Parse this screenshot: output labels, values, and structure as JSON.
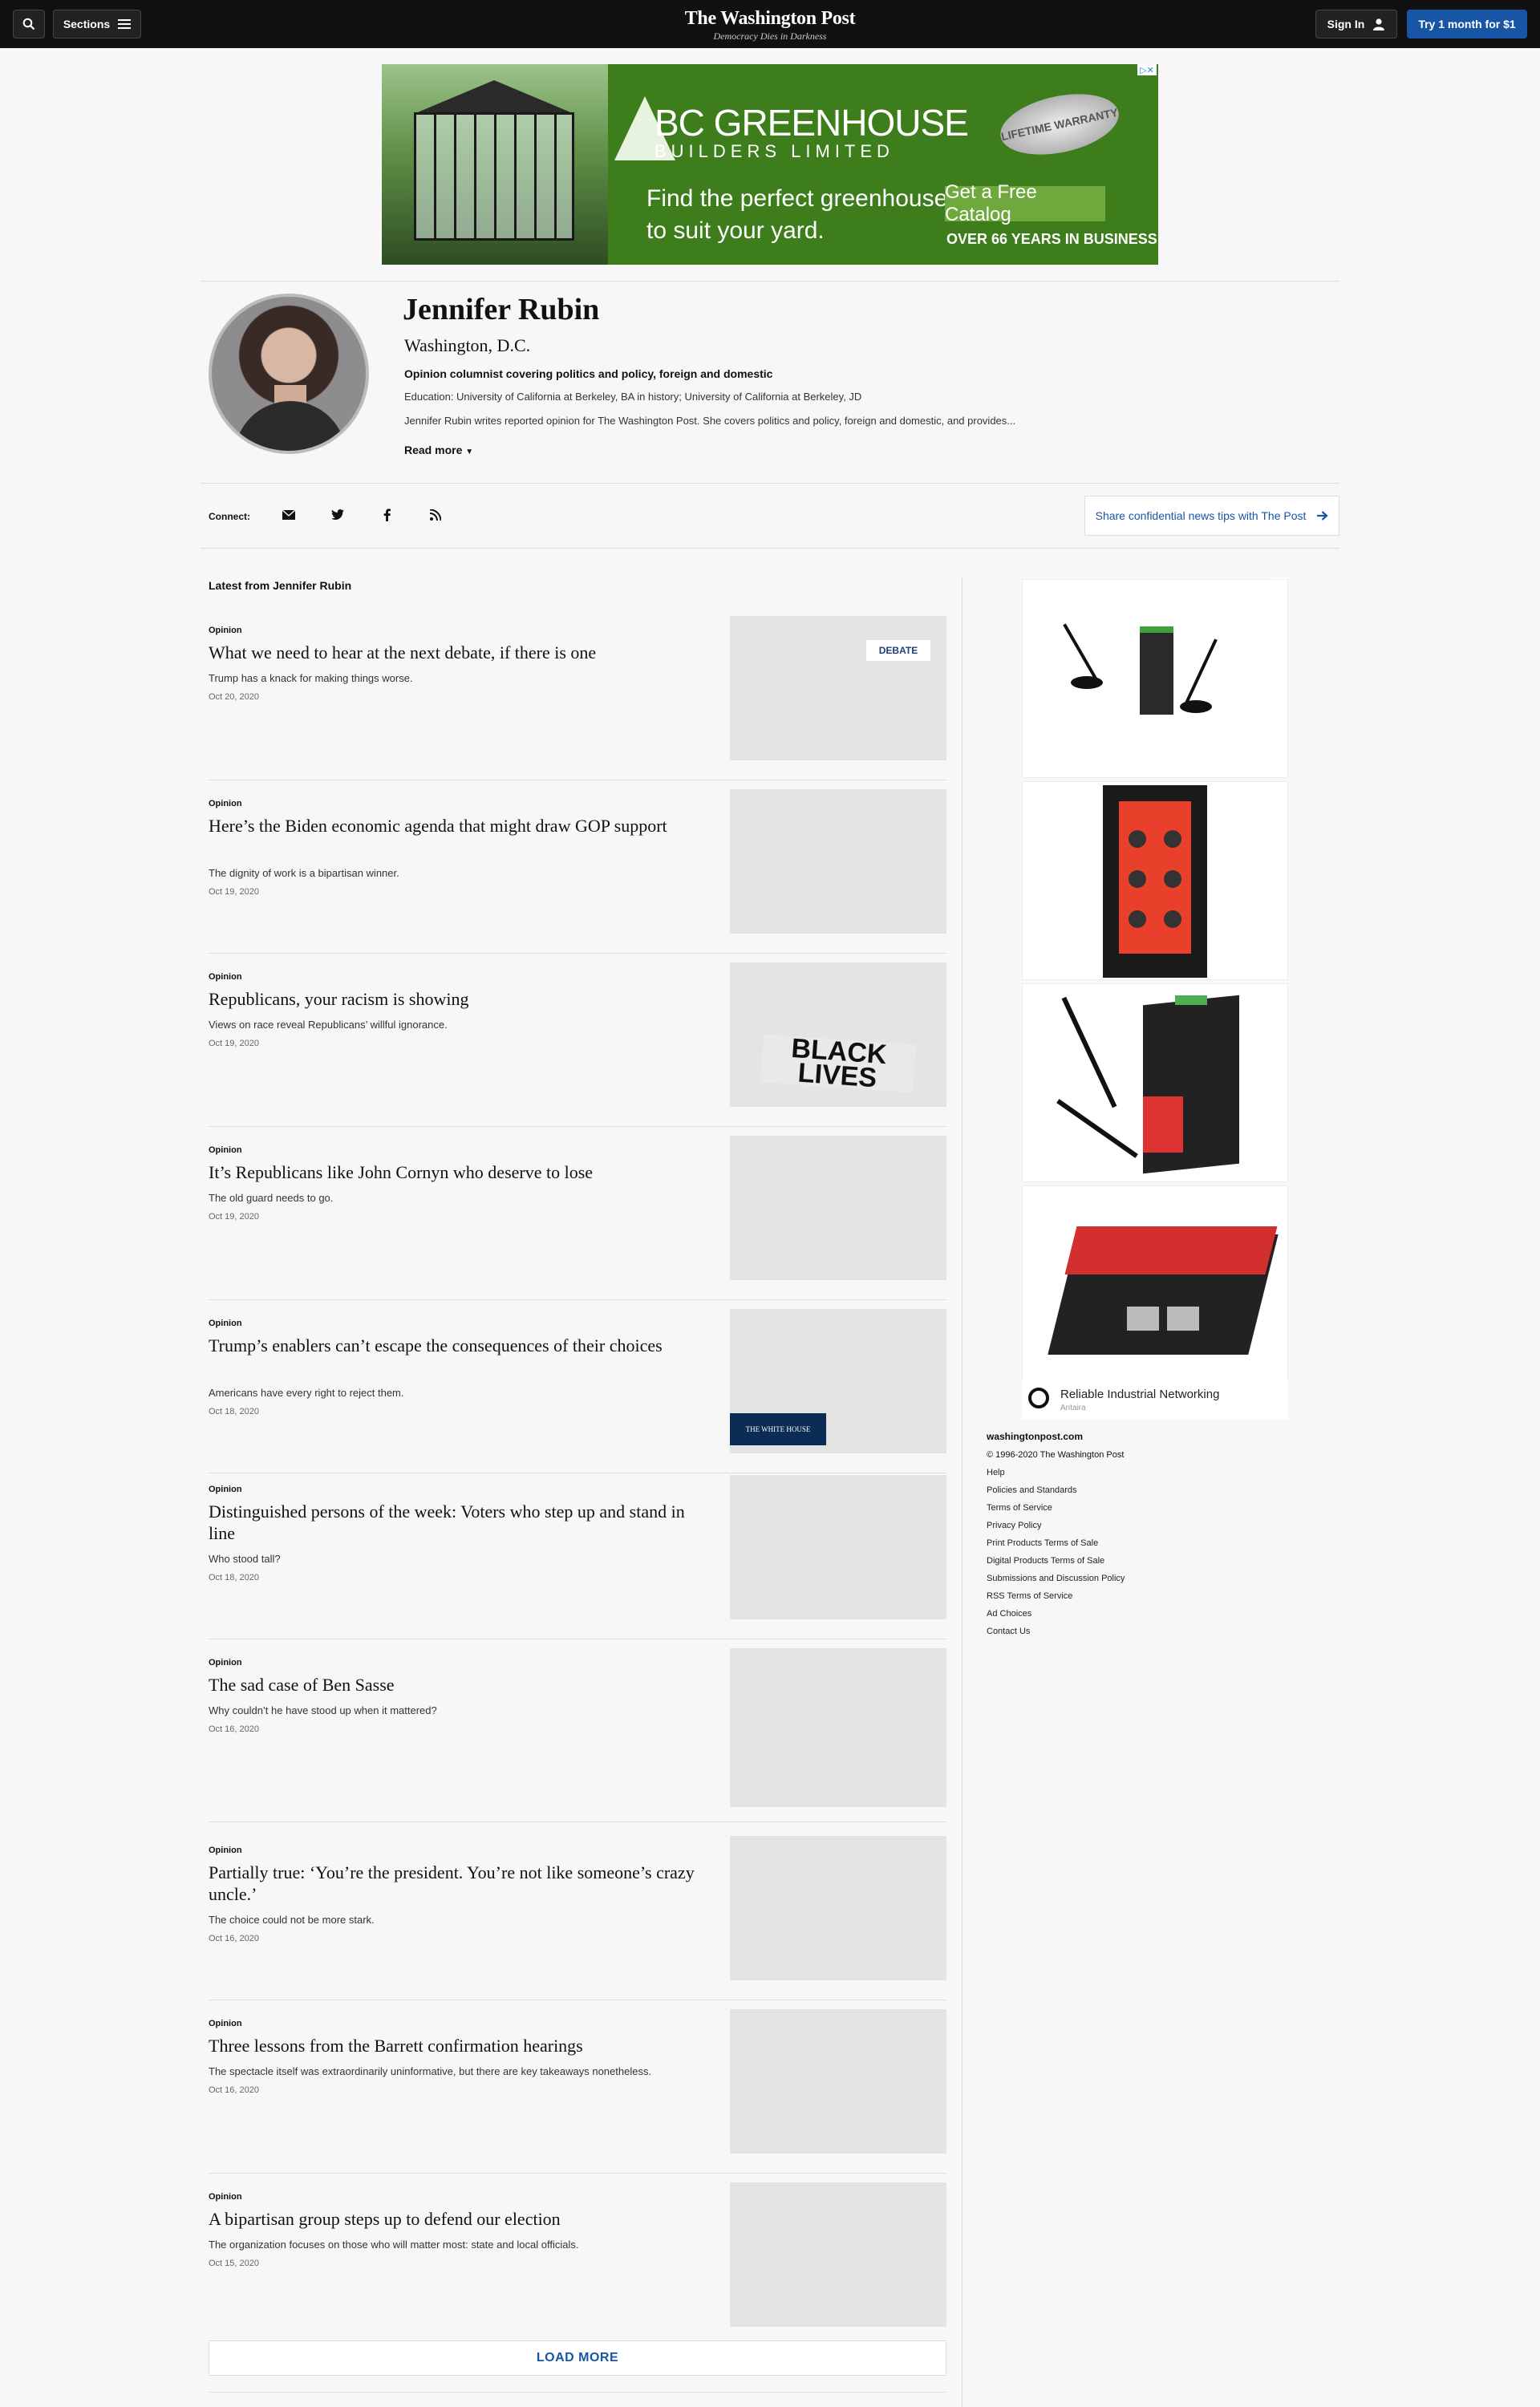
{
  "header": {
    "sections_label": "Sections",
    "logo": "The Washington Post",
    "tagline": "Democracy Dies in Darkness",
    "signin_label": "Sign In",
    "subscribe_label": "Try 1 month for $1"
  },
  "top_ad": {
    "brand_line1": "BC GREENHOUSE",
    "brand_line2": "BUILDERS LIMITED",
    "seal": "LIFETIME WARRANTY",
    "headline_line1": "Find the perfect greenhouse",
    "headline_line2": "to suit your yard.",
    "cta": "Get a Free Catalog",
    "years": "OVER 66 YEARS IN BUSINESS"
  },
  "author": {
    "name": "Jennifer Rubin",
    "location": "Washington, D.C.",
    "role": "Opinion columnist covering politics and policy, foreign and domestic",
    "education": "Education: University of California at Berkeley, BA in history; University of California at Berkeley, JD",
    "bio": "Jennifer Rubin writes reported opinion for The Washington Post. She covers politics and policy, foreign and domestic, and provides...",
    "read_more": "Read more"
  },
  "connect": {
    "label": "Connect:",
    "tips_label": "Share confidential news tips with The Post"
  },
  "latest_label": "Latest from Jennifer Rubin",
  "articles": [
    {
      "kicker": "Opinion",
      "headline": "What we need to hear at the next debate, if there is one",
      "dek": "Trump has a knack for making things worse.",
      "date": "Oct 20, 2020",
      "image_badge": "DEBATE"
    },
    {
      "kicker": "Opinion",
      "headline": "Here’s the Biden economic agenda that might draw GOP support",
      "dek": "The dignity of work is a bipartisan winner.",
      "date": "Oct 19, 2020"
    },
    {
      "kicker": "Opinion",
      "headline": "Republicans, your racism is showing",
      "dek": "Views on race reveal Republicans’ willful ignorance.",
      "date": "Oct 19, 2020",
      "image_badge": "BLACK LIVES"
    },
    {
      "kicker": "Opinion",
      "headline": "It’s Republicans like John Cornyn who deserve to lose",
      "dek": "The old guard needs to go.",
      "date": "Oct 19, 2020"
    },
    {
      "kicker": "Opinion",
      "headline": "Trump’s enablers can’t escape the consequences of their choices",
      "dek": "Americans have every right to reject them.",
      "date": "Oct 18, 2020",
      "image_badge": "THE WHITE HOUSE"
    },
    {
      "kicker": "Opinion",
      "headline": "Distinguished persons of the week: Voters who step up and stand in line",
      "dek": "Who stood tall?",
      "date": "Oct 18, 2020"
    },
    {
      "kicker": "Opinion",
      "headline": "The sad case of Ben Sasse",
      "dek": "Why couldn’t he have stood up when it mattered?",
      "date": "Oct 16, 2020"
    },
    {
      "kicker": "Opinion",
      "headline": "Partially true: ‘You’re the president. You’re not like someone’s crazy uncle.’",
      "dek": "The choice could not be more stark.",
      "date": "Oct 16, 2020"
    },
    {
      "kicker": "Opinion",
      "headline": "Three lessons from the Barrett confirmation hearings",
      "dek": "The spectacle itself was extraordinarily uninformative, but there are key takeaways nonetheless.",
      "date": "Oct 16, 2020"
    },
    {
      "kicker": "Opinion",
      "headline": "A bipartisan group steps up to defend our election",
      "dek": "The organization focuses on those who will matter most: state and local officials.",
      "date": "Oct 15, 2020"
    }
  ],
  "load_more": "LOAD MORE",
  "side_ad": {
    "title": "Reliable Industrial Networking",
    "advertiser": "Antaira"
  },
  "footer": {
    "site": "washingtonpost.com",
    "copyright": "© 1996-2020 The Washington Post",
    "links": [
      "Help",
      "Policies and Standards",
      "Terms of Service",
      "Privacy Policy",
      "Print Products Terms of Sale",
      "Digital Products Terms of Sale",
      "Submissions and Discussion Policy",
      "RSS Terms of Service",
      "Ad Choices",
      "Contact Us"
    ]
  },
  "icons": {
    "search": "search-icon",
    "menu": "hamburger-icon",
    "user": "user-icon",
    "email": "envelope-icon",
    "twitter": "twitter-icon",
    "facebook": "facebook-icon",
    "rss": "rss-icon",
    "arrow": "arrow-right-icon",
    "caret": "caret-down-icon"
  },
  "colors": {
    "brand_blue": "#1955a5",
    "nav_bg": "#111111",
    "page_bg": "#f7f7f7"
  }
}
